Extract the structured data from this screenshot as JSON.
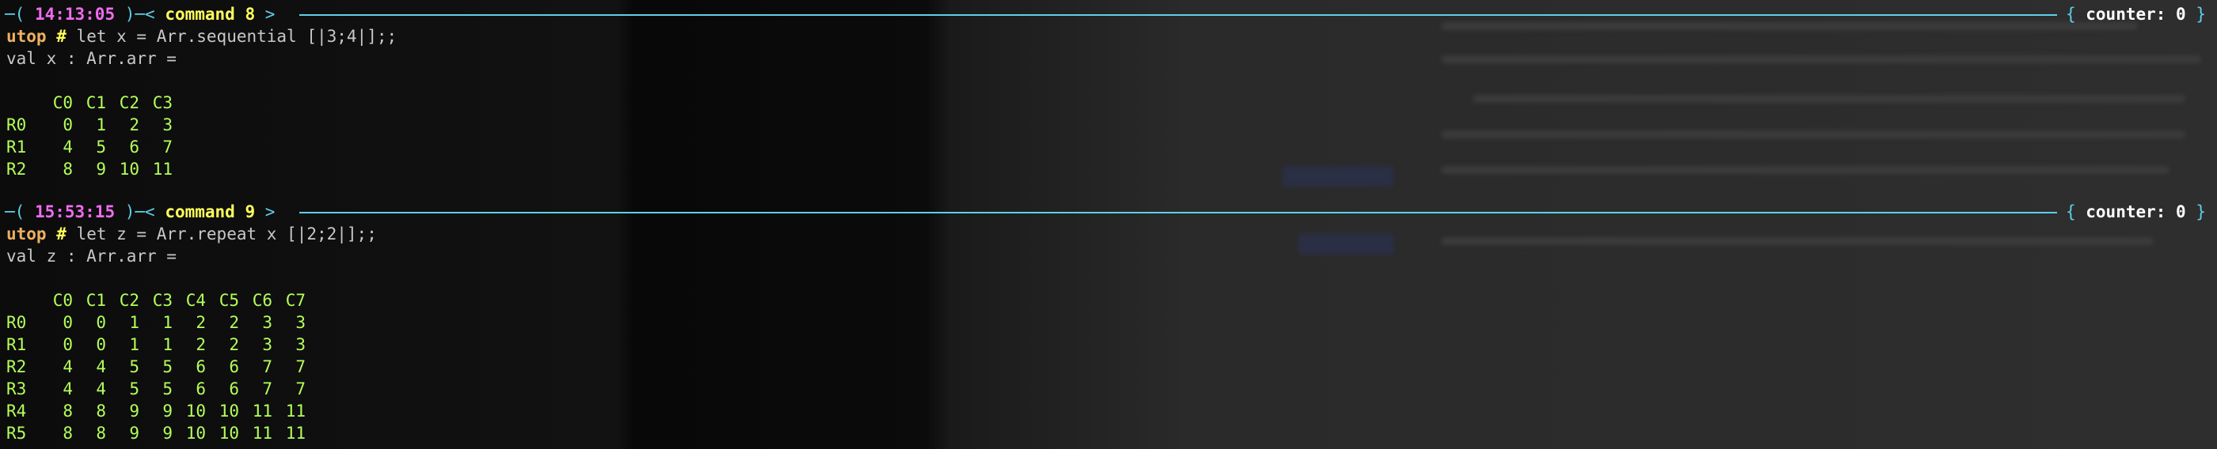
{
  "blocks": [
    {
      "time": "14:13:05",
      "command_label": "command 8",
      "counter": "counter: 0",
      "prompt": "utop",
      "hash": "#",
      "input": "let x = Arr.sequential [|3;4|];;",
      "output_header": "val x : Arr.arr =",
      "columns": [
        "C0",
        "C1",
        "C2",
        "C3"
      ],
      "rows": [
        {
          "label": "R0",
          "values": [
            "0",
            "1",
            "2",
            "3"
          ]
        },
        {
          "label": "R1",
          "values": [
            "4",
            "5",
            "6",
            "7"
          ]
        },
        {
          "label": "R2",
          "values": [
            "8",
            "9",
            "10",
            "11"
          ]
        }
      ]
    },
    {
      "time": "15:53:15",
      "command_label": "command 9",
      "counter": "counter: 0",
      "prompt": "utop",
      "hash": "#",
      "input": "let z = Arr.repeat x [|2;2|];;",
      "output_header": "val z : Arr.arr =",
      "columns": [
        "C0",
        "C1",
        "C2",
        "C3",
        "C4",
        "C5",
        "C6",
        "C7"
      ],
      "rows": [
        {
          "label": "R0",
          "values": [
            "0",
            "0",
            "1",
            "1",
            "2",
            "2",
            "3",
            "3"
          ]
        },
        {
          "label": "R1",
          "values": [
            "0",
            "0",
            "1",
            "1",
            "2",
            "2",
            "3",
            "3"
          ]
        },
        {
          "label": "R2",
          "values": [
            "4",
            "4",
            "5",
            "5",
            "6",
            "6",
            "7",
            "7"
          ]
        },
        {
          "label": "R3",
          "values": [
            "4",
            "4",
            "5",
            "5",
            "6",
            "6",
            "7",
            "7"
          ]
        },
        {
          "label": "R4",
          "values": [
            "8",
            "8",
            "9",
            "9",
            "10",
            "10",
            "11",
            "11"
          ]
        },
        {
          "label": "R5",
          "values": [
            "8",
            "8",
            "9",
            "9",
            "10",
            "10",
            "11",
            "11"
          ]
        }
      ]
    }
  ],
  "colors": {
    "rule": "#5fd0e8",
    "time": "#f06bf0",
    "command": "#ffff5c",
    "prompt": "#f0b060",
    "array": "#b4ff5a",
    "background": "#050505"
  }
}
